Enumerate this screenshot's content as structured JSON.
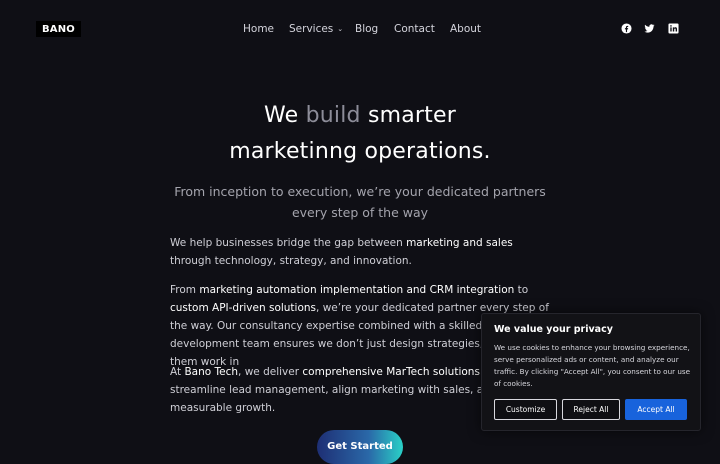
{
  "header": {
    "logo_text": "BANO",
    "nav": [
      {
        "label": "Home"
      },
      {
        "label": "Services",
        "has_dropdown": true
      },
      {
        "label": "Blog"
      },
      {
        "label": "Contact"
      },
      {
        "label": "About"
      }
    ],
    "social_icons": [
      "facebook-icon",
      "twitter-icon",
      "linkedin-icon"
    ]
  },
  "hero": {
    "title_line1_pre": "We",
    "title_line1_accent": "build",
    "title_line1_post": "smarter",
    "title_line2": "marketinng operations.",
    "subtitle_line1": "From inception to execution, we’re your dedicated partners",
    "subtitle_line2": "every step of the way"
  },
  "body": {
    "p1": {
      "t1": "We help businesses bridge the gap between ",
      "b1": "marketing and sales",
      "t2": " through technology, strategy, and innovation."
    },
    "p2": {
      "t1": "From ",
      "b1": "marketing automation implementation and CRM integration",
      "t2": " to ",
      "b2": "custom API-driven solutions",
      "t3": ", we’re your dedicated partner every step of the way. Our consultancy expertise combined with a skilled development team ensures we don’t just design strategies, we make them work in"
    },
    "p3": {
      "t1": "At ",
      "b1": "Bano Tech",
      "t2": ", we deliver ",
      "b2": "comprehensive MarTech solutions",
      "t3": " that streamline lead management, align marketing with sales, and drive measurable growth."
    },
    "cta_label": "Get Started"
  },
  "cookie_banner": {
    "title": "We value your privacy",
    "text": "We use cookies to enhance your browsing experience, serve personalized ads or content, and analyze our traffic. By clicking \"Accept All\", you consent to our use of cookies.",
    "buttons": {
      "customize": "Customize",
      "reject": "Reject All",
      "accept": "Accept All"
    }
  },
  "colors": {
    "background": "#0f0f15",
    "accent_text": "#8d8d99",
    "accept_button": "#1863dc"
  }
}
